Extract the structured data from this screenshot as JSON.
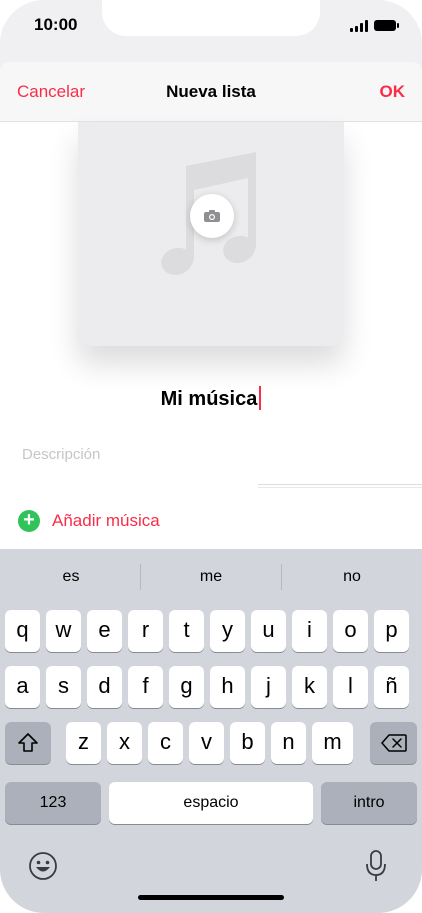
{
  "status_bar": {
    "time": "10:00"
  },
  "nav": {
    "cancel_label": "Cancelar",
    "title": "Nueva lista",
    "ok_label": "OK"
  },
  "playlist": {
    "name": "Mi música",
    "description_placeholder": "Descripción",
    "add_music_label": "Añadir música"
  },
  "keyboard": {
    "suggestions": [
      "es",
      "me",
      "no"
    ],
    "row1": [
      "q",
      "w",
      "e",
      "r",
      "t",
      "y",
      "u",
      "i",
      "o",
      "p"
    ],
    "row2": [
      "a",
      "s",
      "d",
      "f",
      "g",
      "h",
      "j",
      "k",
      "l",
      "ñ"
    ],
    "row3": [
      "z",
      "x",
      "c",
      "v",
      "b",
      "n",
      "m"
    ],
    "numbers_label": "123",
    "space_label": "espacio",
    "return_label": "intro"
  },
  "icons": {
    "shift": "shift-icon",
    "delete": "delete-icon",
    "emoji": "emoji-icon",
    "microphone": "microphone-icon",
    "camera": "camera-icon",
    "music_note": "music-note-icon"
  },
  "colors": {
    "accent": "#fa2d48",
    "add_button": "#30c35a",
    "keyboard_bg": "#d2d5db"
  }
}
